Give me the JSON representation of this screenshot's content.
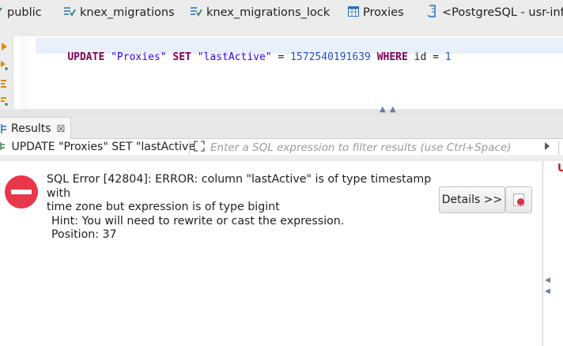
{
  "tabs": [
    {
      "label": "public",
      "icon": "schema-icon",
      "color": "#2e8b57"
    },
    {
      "label": "knex_migrations",
      "icon": "table-icon",
      "color": "#2e8b57"
    },
    {
      "label": "knex_migrations_lock",
      "icon": "table-icon",
      "color": "#2e8b57"
    },
    {
      "label": "Proxies",
      "icon": "table-grid-icon",
      "color": "#2a6ebb"
    },
    {
      "label": "<PostgreSQL - usr-inf",
      "icon": "sql-editor-icon",
      "color": "#2a6ebb"
    }
  ],
  "editor": {
    "sql_tokens": [
      {
        "text": "UPDATE",
        "kind": "kw"
      },
      {
        "text": " ",
        "kind": "plain"
      },
      {
        "text": "\"Proxies\"",
        "kind": "str"
      },
      {
        "text": " ",
        "kind": "plain"
      },
      {
        "text": "SET",
        "kind": "kw"
      },
      {
        "text": " ",
        "kind": "plain"
      },
      {
        "text": "\"lastActive\"",
        "kind": "str"
      },
      {
        "text": " = ",
        "kind": "plain"
      },
      {
        "text": "1572540191639",
        "kind": "num"
      },
      {
        "text": " ",
        "kind": "plain"
      },
      {
        "text": "WHERE",
        "kind": "kw"
      },
      {
        "text": " id = ",
        "kind": "plain"
      },
      {
        "text": "1",
        "kind": "num"
      }
    ]
  },
  "results_panel": {
    "tab_label": "Results",
    "close_glyph": "☒",
    "query_label": "UPDATE \"Proxies\" SET \"lastActive",
    "filter_placeholder": "Enter a SQL expression to filter results (use Ctrl+Space)"
  },
  "error": {
    "line1": "SQL Error [42804]: ERROR: column \"lastActive\" is of type timestamp with",
    "line2": "time zone but expression is of type bigint",
    "hint": "Hint: You will need to rewrite or cast the expression.",
    "position": "Position: 37",
    "details_button": "Details >>"
  },
  "right_strip": {
    "letter": "U"
  },
  "colors": {
    "error_icon": "#e8374a",
    "keyword": "#7f0055",
    "string": "#2a00ff",
    "number": "#1a4fcc",
    "current_line": "#e8f0fb"
  }
}
